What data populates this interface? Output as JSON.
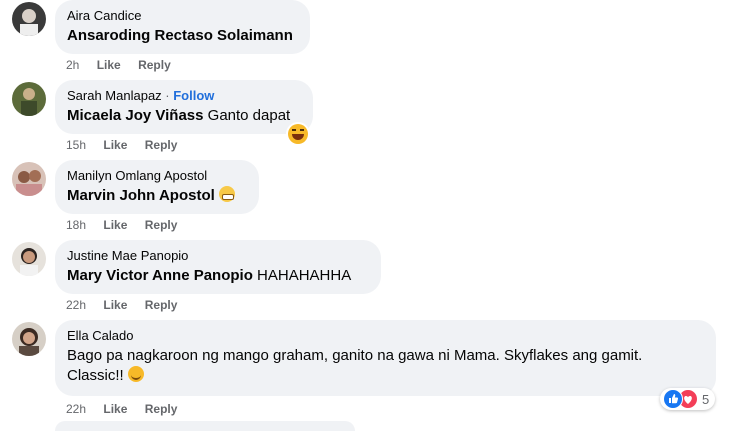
{
  "comments": [
    {
      "author": "Aira Candice",
      "tag": "Ansaroding Rectaso Solaimann",
      "text": "",
      "time": "2h",
      "like": "Like",
      "reply": "Reply"
    },
    {
      "author": "Sarah Manlapaz",
      "separator": " · ",
      "follow": "Follow",
      "tag": "Micaela Joy Viñass",
      "text": " Ganto dapat",
      "time": "15h",
      "like": "Like",
      "reply": "Reply",
      "emoji": "laughing-emoji"
    },
    {
      "author": "Manilyn Omlang Apostol",
      "tag": "Marvin John Apostol",
      "text": "",
      "time": "18h",
      "like": "Like",
      "reply": "Reply",
      "emoji": "grimace-emoji"
    },
    {
      "author": "Justine Mae Panopio",
      "tag": "Mary Victor Anne Panopio",
      "text": " HAHAHAHHA",
      "time": "22h",
      "like": "Like",
      "reply": "Reply"
    },
    {
      "author": "Ella Calado",
      "text": "Bago pa nagkaroon ng mango graham, ganito na gawa ni Mama. Skyflakes ang gamit.",
      "text2": "Classic!!",
      "time": "22h",
      "like": "Like",
      "reply": "Reply",
      "emoji": "smile-emoji",
      "reactions": {
        "count": "5",
        "icons": [
          "like-reaction-icon",
          "love-reaction-icon"
        ]
      }
    }
  ],
  "colors": {
    "bubble": "#f0f2f5",
    "meta": "#65676b",
    "follow": "#216fdb",
    "like_reaction": "#1877f2",
    "love_reaction": "#f33e58"
  }
}
